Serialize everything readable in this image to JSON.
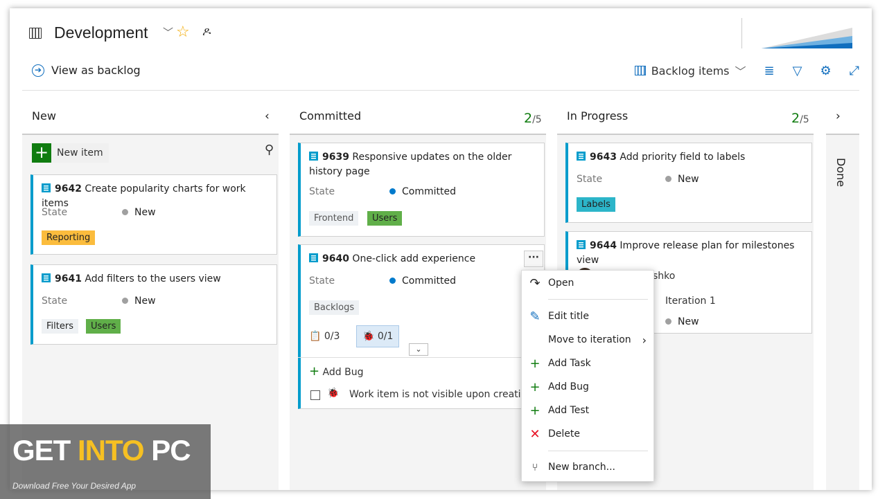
{
  "header": {
    "title": "Development",
    "view_as_backlog": "View as backlog",
    "backlog_selector": "Backlog items"
  },
  "columns": [
    {
      "name": "New"
    },
    {
      "name": "Committed",
      "count": "2",
      "limit": "/5"
    },
    {
      "name": "In Progress",
      "count": "2",
      "limit": "/5"
    },
    {
      "name": "Done"
    }
  ],
  "new_item_label": "New item",
  "state_label": "State",
  "cards": {
    "c9642": {
      "id": "9642",
      "title": "Create popularity charts for work items",
      "state": "New",
      "tags": [
        "Reporting"
      ]
    },
    "c9641": {
      "id": "9641",
      "title": "Add filters to the users view",
      "state": "New",
      "tags": [
        "Filters",
        "Users"
      ]
    },
    "c9639": {
      "id": "9639",
      "title": "Responsive updates on the older history page",
      "state": "Committed",
      "tags": [
        "Frontend",
        "Users"
      ]
    },
    "c9640": {
      "id": "9640",
      "title": "One-click add experience",
      "state": "Committed",
      "tags": [
        "Backlogs"
      ],
      "tasks": "0/3",
      "bugs": "0/1",
      "add_bug": "Add Bug",
      "child_item": "Work item is not visible upon creation"
    },
    "c9643": {
      "id": "9643",
      "title": "Add priority field to labels",
      "state": "New",
      "tags": [
        "Labels"
      ]
    },
    "c9644": {
      "id": "9644",
      "title": "Improve release plan for milestones view",
      "assignee_partial": "shko",
      "iteration": "Iteration 1",
      "state": "New"
    }
  },
  "context_menu": {
    "items": [
      "Open",
      "Edit title",
      "Move to iteration",
      "Add Task",
      "Add Bug",
      "Add Test",
      "Delete",
      "New branch..."
    ]
  },
  "watermark": {
    "title_a": "GET ",
    "title_b": "INTO",
    "title_c": " PC",
    "subtitle": "Download Free Your Desired App"
  },
  "colors": {
    "accent": "#106ebe",
    "card_stripe": "#009ccc",
    "green": "#107c10",
    "committed_dot": "#007acc",
    "new_dot": "#a0a0a0",
    "tag_reporting": "#fbbc3d",
    "tag_users": "#60af49",
    "tag_labels": "#2cb5c9",
    "delete_red": "#e81123"
  }
}
